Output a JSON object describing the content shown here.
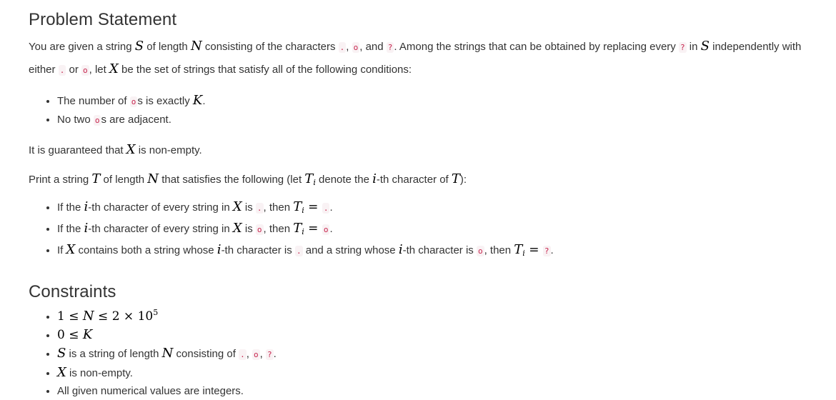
{
  "problem": {
    "heading": "Problem Statement",
    "p1": {
      "t1": "You are given a string ",
      "S": "S",
      "t2": " of length ",
      "N": "N",
      "t3": " consisting of the characters ",
      "c_dot": ".",
      "t4": ", ",
      "c_o": "o",
      "t5": ", and ",
      "c_q": "?",
      "t6": ". Among the strings that can be obtained by replacing every ",
      "c_q2": "?",
      "t7": " in ",
      "S2": "S",
      "t8": " independently with either ",
      "c_dot2": ".",
      "t9": " or ",
      "c_o2": "o",
      "t10": ", let ",
      "X": "X",
      "t11": " be the set of strings that satisfy all of the following conditions:"
    },
    "conditions": [
      {
        "a": "The number of ",
        "code": "o",
        "b": "s is exactly ",
        "math": "K",
        "c": "."
      },
      {
        "a": "No two ",
        "code": "o",
        "b": "s are adjacent.",
        "math": "",
        "c": ""
      }
    ],
    "p2": {
      "a": "It is guaranteed that ",
      "X": "X",
      "b": " is non-empty."
    },
    "p3": {
      "a": "Print a string ",
      "T": "T",
      "b": " of length ",
      "N": "N",
      "c": " that satisfies the following (let ",
      "Ti": "T",
      "i": "i",
      "d": " denote the ",
      "i2": "i",
      "e": "-th character of ",
      "T2": "T",
      "f": "):"
    },
    "rules": [
      {
        "a": "If the ",
        "i": "i",
        "b": "-th character of every string in ",
        "X": "X",
        "c": " is ",
        "code": ".",
        "d": ", then ",
        "T": "T",
        "sub": "i",
        "eq": " = ",
        "code2": ".",
        "e": "."
      },
      {
        "a": "If the ",
        "i": "i",
        "b": "-th character of every string in ",
        "X": "X",
        "c": " is ",
        "code": "o",
        "d": ", then ",
        "T": "T",
        "sub": "i",
        "eq": " = ",
        "code2": "o",
        "e": "."
      },
      {
        "a": "If ",
        "X": "X",
        "b": " contains both a string whose ",
        "i": "i",
        "c": "-th character is ",
        "code": ".",
        "d": " and a string whose ",
        "i2": "i",
        "e": "-th character is ",
        "code2": "o",
        "f": ", then ",
        "T": "T",
        "sub": "i",
        "eq": " = ",
        "code3": "?",
        "g": "."
      }
    ]
  },
  "constraints": {
    "heading": "Constraints",
    "c1": {
      "one": "1",
      "le1": " ≤ ",
      "N": "N",
      "le2": " ≤ ",
      "two": "2",
      "times": " × ",
      "ten": "10",
      "exp": "5"
    },
    "c2": {
      "zero": "0",
      "le": " ≤ ",
      "K": "K"
    },
    "c3": {
      "S": "S",
      "a": " is a string of length ",
      "N": "N",
      "b": " consisting of ",
      "c1": ".",
      "sep1": ", ",
      "c2": "o",
      "sep2": ", ",
      "c3": "?",
      "end": "."
    },
    "c4": {
      "X": "X",
      "a": " is non-empty."
    },
    "c5": "All given numerical values are integers."
  }
}
